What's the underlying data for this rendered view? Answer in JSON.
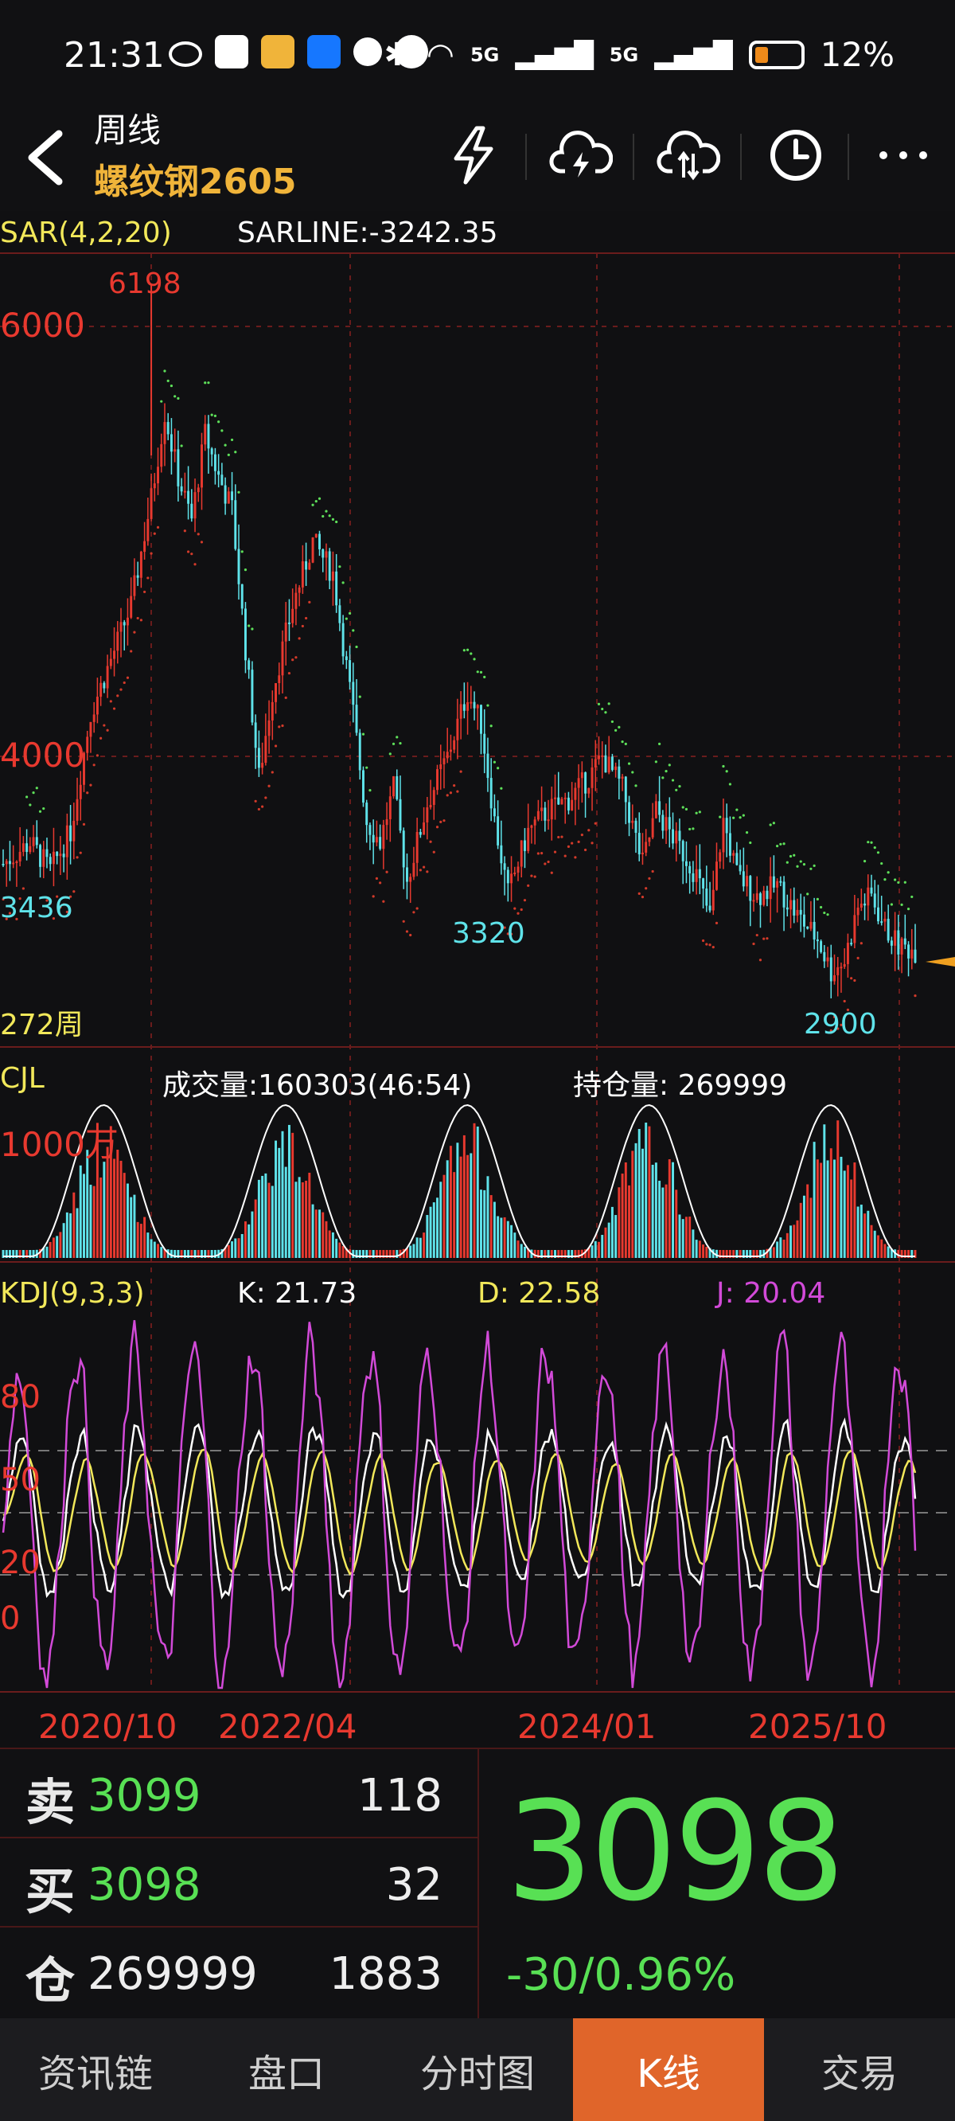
{
  "status_bar": {
    "time": "21:31",
    "net1": "5G",
    "net2": "5G",
    "battery": "12%",
    "battery_level": 0.12
  },
  "nav": {
    "title": "周线",
    "subtitle": "螺纹钢2605",
    "icons": [
      "back-icon",
      "flash-icon",
      "cloud-lightning-icon",
      "cloud-sync-icon",
      "clock-icon",
      "more-icon"
    ]
  },
  "main_chart": {
    "indicator_label": "SAR(4,2,20)",
    "sarline_label": "SARLINE:-3242.35",
    "y_tick_6000": "6000",
    "y_tick_4000": "4000",
    "high_label": "6198",
    "low_left_label": "3436",
    "low_mid_label": "3320",
    "low_right_label": "2900",
    "period_label": "272周"
  },
  "volume_chart": {
    "indicator_label": "CJL",
    "volume_label": "成交量:160303(46:54)",
    "oi_label": "持仓量: 269999",
    "scale_label": "1000万"
  },
  "kdj_chart": {
    "indicator_label": "KDJ(9,3,3)",
    "k_label": "K: 21.73",
    "d_label": "D: 22.58",
    "j_label": "J: 20.04",
    "level_80": "80",
    "level_50": "50",
    "level_20": "20",
    "level_0": "0"
  },
  "x_axis": [
    "2020/10",
    "2022/04",
    "2024/01",
    "2025/10"
  ],
  "quote": {
    "sell_label": "卖",
    "sell_price": "3099",
    "sell_volume": "118",
    "buy_label": "买",
    "buy_price": "3098",
    "buy_volume": "32",
    "oi_label": "仓",
    "oi_value": "269999",
    "oi_change": "1883",
    "last_price": "3098",
    "change": "-30/0.96%"
  },
  "tabs": [
    {
      "label": "资讯链",
      "active": false
    },
    {
      "label": "盘口",
      "active": false
    },
    {
      "label": "分时图",
      "active": false
    },
    {
      "label": "K线",
      "active": true
    },
    {
      "label": "交易",
      "active": false
    }
  ],
  "colors": {
    "up": "#e8392f",
    "down": "#5fe3ea",
    "price_green": "#58e054",
    "accent_orange": "#e0652a",
    "title_gold": "#f0b43a",
    "k_line": "#ffffff",
    "d_line": "#f2e85a",
    "j_line": "#d24ad8"
  },
  "chart_data": {
    "type": "candlestick",
    "period": "weekly",
    "bars": 272,
    "y_ticks": [
      6000,
      4000
    ],
    "annotated_high": 6198,
    "annotated_lows": [
      3436,
      3320,
      2900
    ],
    "last": 3098,
    "sar_line": -3242.35,
    "volume": 160303,
    "open_interest": 269999,
    "kdj": {
      "K": 21.73,
      "D": 22.58,
      "J": 20.04,
      "levels": [
        80,
        50,
        20,
        0
      ]
    },
    "x_labels": [
      "2020/10",
      "2022/04",
      "2024/01",
      "2025/10"
    ],
    "price_path": [
      [
        0,
        3500
      ],
      [
        8,
        3600
      ],
      [
        14,
        3470
      ],
      [
        20,
        3650
      ],
      [
        26,
        4200
      ],
      [
        32,
        4450
      ],
      [
        38,
        4700
      ],
      [
        44,
        5200
      ],
      [
        48,
        5600
      ],
      [
        52,
        5300
      ],
      [
        56,
        5100
      ],
      [
        60,
        5500
      ],
      [
        64,
        5300
      ],
      [
        68,
        5150
      ],
      [
        72,
        4500
      ],
      [
        76,
        3900
      ],
      [
        80,
        4300
      ],
      [
        86,
        4700
      ],
      [
        92,
        5000
      ],
      [
        98,
        4850
      ],
      [
        104,
        4200
      ],
      [
        108,
        3700
      ],
      [
        112,
        3600
      ],
      [
        116,
        3850
      ],
      [
        120,
        3420
      ],
      [
        126,
        3780
      ],
      [
        132,
        4000
      ],
      [
        138,
        4300
      ],
      [
        142,
        4150
      ],
      [
        146,
        3700
      ],
      [
        150,
        3360
      ],
      [
        156,
        3650
      ],
      [
        162,
        3750
      ],
      [
        168,
        3800
      ],
      [
        174,
        3900
      ],
      [
        178,
        4000
      ],
      [
        184,
        3850
      ],
      [
        190,
        3500
      ],
      [
        194,
        3750
      ],
      [
        200,
        3600
      ],
      [
        206,
        3450
      ],
      [
        210,
        3250
      ],
      [
        214,
        3700
      ],
      [
        218,
        3450
      ],
      [
        224,
        3350
      ],
      [
        230,
        3400
      ],
      [
        236,
        3260
      ],
      [
        242,
        3150
      ],
      [
        246,
        3000
      ],
      [
        250,
        3050
      ],
      [
        254,
        3300
      ],
      [
        258,
        3350
      ],
      [
        262,
        3200
      ],
      [
        266,
        3120
      ],
      [
        271,
        3098
      ]
    ]
  }
}
